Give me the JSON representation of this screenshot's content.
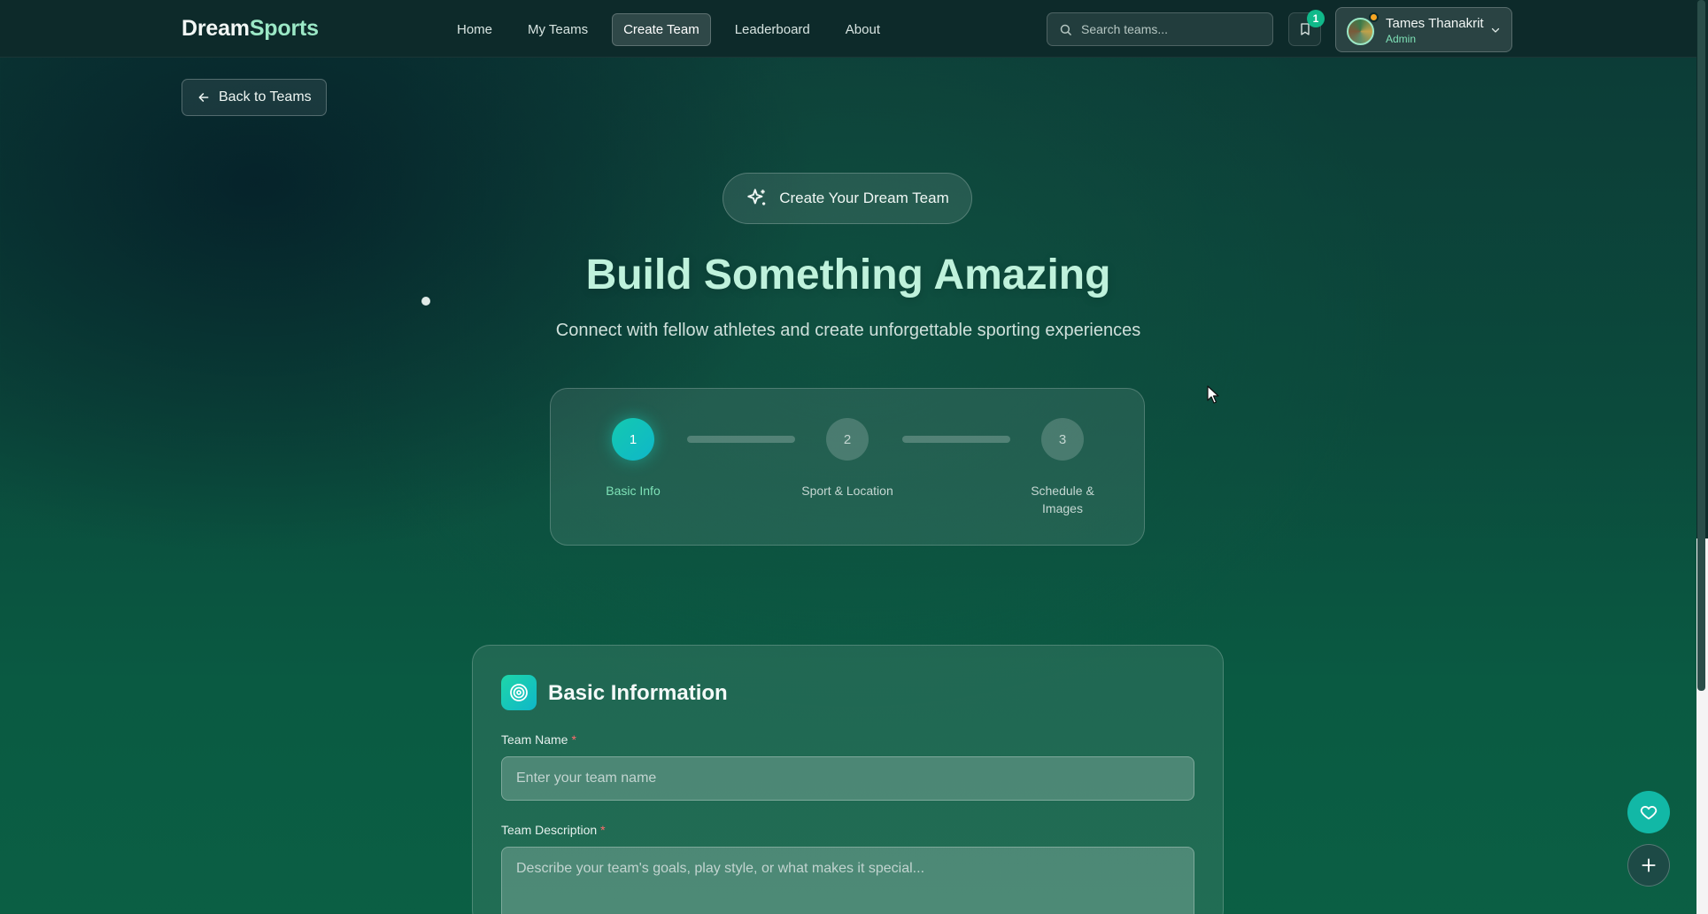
{
  "brand": {
    "part1": "Dream",
    "part2": "Sports"
  },
  "nav": {
    "links": [
      {
        "label": "Home",
        "active": false
      },
      {
        "label": "My Teams",
        "active": false
      },
      {
        "label": "Create Team",
        "active": true
      },
      {
        "label": "Leaderboard",
        "active": false
      },
      {
        "label": "About",
        "active": false
      }
    ],
    "search_placeholder": "Search teams...",
    "bookmark_count": "1",
    "user": {
      "name": "Tames Thanakrit",
      "role": "Admin"
    }
  },
  "back_button": {
    "label": "Back to Teams"
  },
  "hero": {
    "pill": "Create Your Dream Team",
    "title": "Build Something Amazing",
    "subtitle": "Connect with fellow athletes and create unforgettable sporting experiences"
  },
  "stepper": {
    "current_step": 1,
    "steps": [
      {
        "number": "1",
        "label": "Basic Info"
      },
      {
        "number": "2",
        "label": "Sport & Location"
      },
      {
        "number": "3",
        "label": "Schedule & Images"
      }
    ]
  },
  "form": {
    "section_title": "Basic Information",
    "team_name": {
      "label": "Team Name",
      "required_mark": "*",
      "placeholder": "Enter your team name",
      "value": ""
    },
    "team_description": {
      "label": "Team Description",
      "required_mark": "*",
      "placeholder": "Describe your team's goals, play style, or what makes it special...",
      "value": ""
    }
  },
  "fabs": {
    "favorite_icon": "heart-icon",
    "add_icon": "plus-icon"
  },
  "colors": {
    "accent": "#12b8a6",
    "brand_highlight": "#9be8c6",
    "required": "#ff6b6b"
  }
}
